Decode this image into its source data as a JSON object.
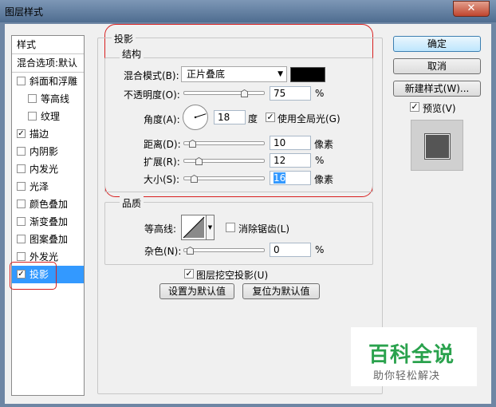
{
  "window": {
    "title": "图层样式",
    "close_glyph": "✕"
  },
  "stylelist": {
    "header": "样式",
    "blend_options": "混合选项:默认",
    "items": [
      {
        "label": "斜面和浮雕",
        "checked": false,
        "indent": false
      },
      {
        "label": "等高线",
        "checked": false,
        "indent": true
      },
      {
        "label": "纹理",
        "checked": false,
        "indent": true
      },
      {
        "label": "描边",
        "checked": true,
        "indent": false
      },
      {
        "label": "内阴影",
        "checked": false,
        "indent": false
      },
      {
        "label": "内发光",
        "checked": false,
        "indent": false
      },
      {
        "label": "光泽",
        "checked": false,
        "indent": false
      },
      {
        "label": "颜色叠加",
        "checked": false,
        "indent": false
      },
      {
        "label": "渐变叠加",
        "checked": false,
        "indent": false
      },
      {
        "label": "图案叠加",
        "checked": false,
        "indent": false
      },
      {
        "label": "外发光",
        "checked": false,
        "indent": false
      },
      {
        "label": "投影",
        "checked": true,
        "indent": false,
        "selected": true
      }
    ]
  },
  "shadow": {
    "title": "投影",
    "structure": {
      "title": "结构",
      "blend_mode_label": "混合模式(B):",
      "blend_mode_value": "正片叠底",
      "shadow_color": "#000000",
      "opacity_label": "不透明度(O):",
      "opacity_value": "75",
      "opacity_unit": "%",
      "opacity_fraction": 0.75,
      "angle_label": "角度(A):",
      "angle_value": "18",
      "angle_unit": "度",
      "global_light_label": "使用全局光(G)",
      "global_light_checked": true,
      "distance_label": "距离(D):",
      "distance_value": "10",
      "distance_unit": "像素",
      "distance_fraction": 0.03,
      "spread_label": "扩展(R):",
      "spread_value": "12",
      "spread_unit": "%",
      "spread_fraction": 0.12,
      "size_label": "大小(S):",
      "size_value": "16",
      "size_unit": "像素",
      "size_fraction": 0.06
    },
    "quality": {
      "title": "品质",
      "contour_label": "等高线:",
      "antialias_label": "消除锯齿(L)",
      "antialias_checked": false,
      "noise_label": "杂色(N):",
      "noise_value": "0",
      "noise_unit": "%",
      "noise_fraction": 0.0
    },
    "knockout_label": "图层挖空投影(U)",
    "knockout_checked": true,
    "make_default": "设置为默认值",
    "reset_default": "复位为默认值"
  },
  "buttons": {
    "ok": "确定",
    "cancel": "取消",
    "new_style": "新建样式(W)...",
    "preview_label": "预览(V)",
    "preview_checked": true
  },
  "watermark": {
    "title": "百科全说",
    "subtitle": "助你轻松解决"
  },
  "colors": {
    "selection": "#3399ff",
    "annotation": "#d81e1e",
    "watermark_green": "#2aa24d"
  }
}
